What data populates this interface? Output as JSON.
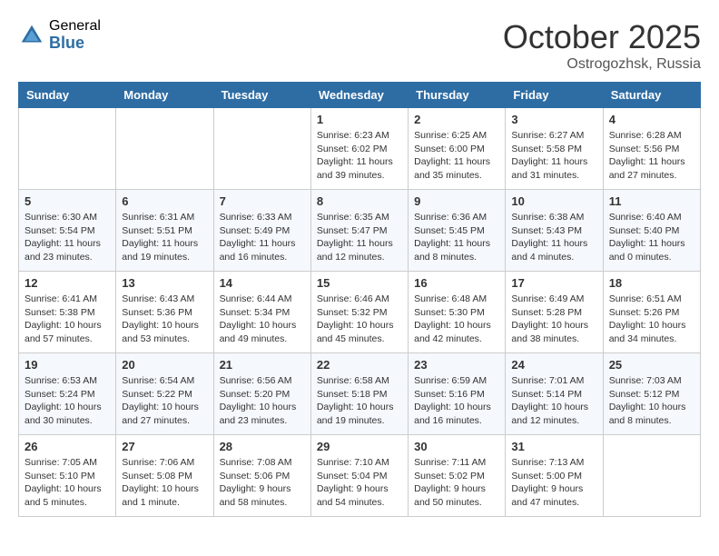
{
  "header": {
    "logo_general": "General",
    "logo_blue": "Blue",
    "month_title": "October 2025",
    "location": "Ostrogozhsk, Russia"
  },
  "weekdays": [
    "Sunday",
    "Monday",
    "Tuesday",
    "Wednesday",
    "Thursday",
    "Friday",
    "Saturday"
  ],
  "rows": [
    [
      {
        "day": "",
        "info": ""
      },
      {
        "day": "",
        "info": ""
      },
      {
        "day": "",
        "info": ""
      },
      {
        "day": "1",
        "info": "Sunrise: 6:23 AM\nSunset: 6:02 PM\nDaylight: 11 hours\nand 39 minutes."
      },
      {
        "day": "2",
        "info": "Sunrise: 6:25 AM\nSunset: 6:00 PM\nDaylight: 11 hours\nand 35 minutes."
      },
      {
        "day": "3",
        "info": "Sunrise: 6:27 AM\nSunset: 5:58 PM\nDaylight: 11 hours\nand 31 minutes."
      },
      {
        "day": "4",
        "info": "Sunrise: 6:28 AM\nSunset: 5:56 PM\nDaylight: 11 hours\nand 27 minutes."
      }
    ],
    [
      {
        "day": "5",
        "info": "Sunrise: 6:30 AM\nSunset: 5:54 PM\nDaylight: 11 hours\nand 23 minutes."
      },
      {
        "day": "6",
        "info": "Sunrise: 6:31 AM\nSunset: 5:51 PM\nDaylight: 11 hours\nand 19 minutes."
      },
      {
        "day": "7",
        "info": "Sunrise: 6:33 AM\nSunset: 5:49 PM\nDaylight: 11 hours\nand 16 minutes."
      },
      {
        "day": "8",
        "info": "Sunrise: 6:35 AM\nSunset: 5:47 PM\nDaylight: 11 hours\nand 12 minutes."
      },
      {
        "day": "9",
        "info": "Sunrise: 6:36 AM\nSunset: 5:45 PM\nDaylight: 11 hours\nand 8 minutes."
      },
      {
        "day": "10",
        "info": "Sunrise: 6:38 AM\nSunset: 5:43 PM\nDaylight: 11 hours\nand 4 minutes."
      },
      {
        "day": "11",
        "info": "Sunrise: 6:40 AM\nSunset: 5:40 PM\nDaylight: 11 hours\nand 0 minutes."
      }
    ],
    [
      {
        "day": "12",
        "info": "Sunrise: 6:41 AM\nSunset: 5:38 PM\nDaylight: 10 hours\nand 57 minutes."
      },
      {
        "day": "13",
        "info": "Sunrise: 6:43 AM\nSunset: 5:36 PM\nDaylight: 10 hours\nand 53 minutes."
      },
      {
        "day": "14",
        "info": "Sunrise: 6:44 AM\nSunset: 5:34 PM\nDaylight: 10 hours\nand 49 minutes."
      },
      {
        "day": "15",
        "info": "Sunrise: 6:46 AM\nSunset: 5:32 PM\nDaylight: 10 hours\nand 45 minutes."
      },
      {
        "day": "16",
        "info": "Sunrise: 6:48 AM\nSunset: 5:30 PM\nDaylight: 10 hours\nand 42 minutes."
      },
      {
        "day": "17",
        "info": "Sunrise: 6:49 AM\nSunset: 5:28 PM\nDaylight: 10 hours\nand 38 minutes."
      },
      {
        "day": "18",
        "info": "Sunrise: 6:51 AM\nSunset: 5:26 PM\nDaylight: 10 hours\nand 34 minutes."
      }
    ],
    [
      {
        "day": "19",
        "info": "Sunrise: 6:53 AM\nSunset: 5:24 PM\nDaylight: 10 hours\nand 30 minutes."
      },
      {
        "day": "20",
        "info": "Sunrise: 6:54 AM\nSunset: 5:22 PM\nDaylight: 10 hours\nand 27 minutes."
      },
      {
        "day": "21",
        "info": "Sunrise: 6:56 AM\nSunset: 5:20 PM\nDaylight: 10 hours\nand 23 minutes."
      },
      {
        "day": "22",
        "info": "Sunrise: 6:58 AM\nSunset: 5:18 PM\nDaylight: 10 hours\nand 19 minutes."
      },
      {
        "day": "23",
        "info": "Sunrise: 6:59 AM\nSunset: 5:16 PM\nDaylight: 10 hours\nand 16 minutes."
      },
      {
        "day": "24",
        "info": "Sunrise: 7:01 AM\nSunset: 5:14 PM\nDaylight: 10 hours\nand 12 minutes."
      },
      {
        "day": "25",
        "info": "Sunrise: 7:03 AM\nSunset: 5:12 PM\nDaylight: 10 hours\nand 8 minutes."
      }
    ],
    [
      {
        "day": "26",
        "info": "Sunrise: 7:05 AM\nSunset: 5:10 PM\nDaylight: 10 hours\nand 5 minutes."
      },
      {
        "day": "27",
        "info": "Sunrise: 7:06 AM\nSunset: 5:08 PM\nDaylight: 10 hours\nand 1 minute."
      },
      {
        "day": "28",
        "info": "Sunrise: 7:08 AM\nSunset: 5:06 PM\nDaylight: 9 hours\nand 58 minutes."
      },
      {
        "day": "29",
        "info": "Sunrise: 7:10 AM\nSunset: 5:04 PM\nDaylight: 9 hours\nand 54 minutes."
      },
      {
        "day": "30",
        "info": "Sunrise: 7:11 AM\nSunset: 5:02 PM\nDaylight: 9 hours\nand 50 minutes."
      },
      {
        "day": "31",
        "info": "Sunrise: 7:13 AM\nSunset: 5:00 PM\nDaylight: 9 hours\nand 47 minutes."
      },
      {
        "day": "",
        "info": ""
      }
    ]
  ]
}
